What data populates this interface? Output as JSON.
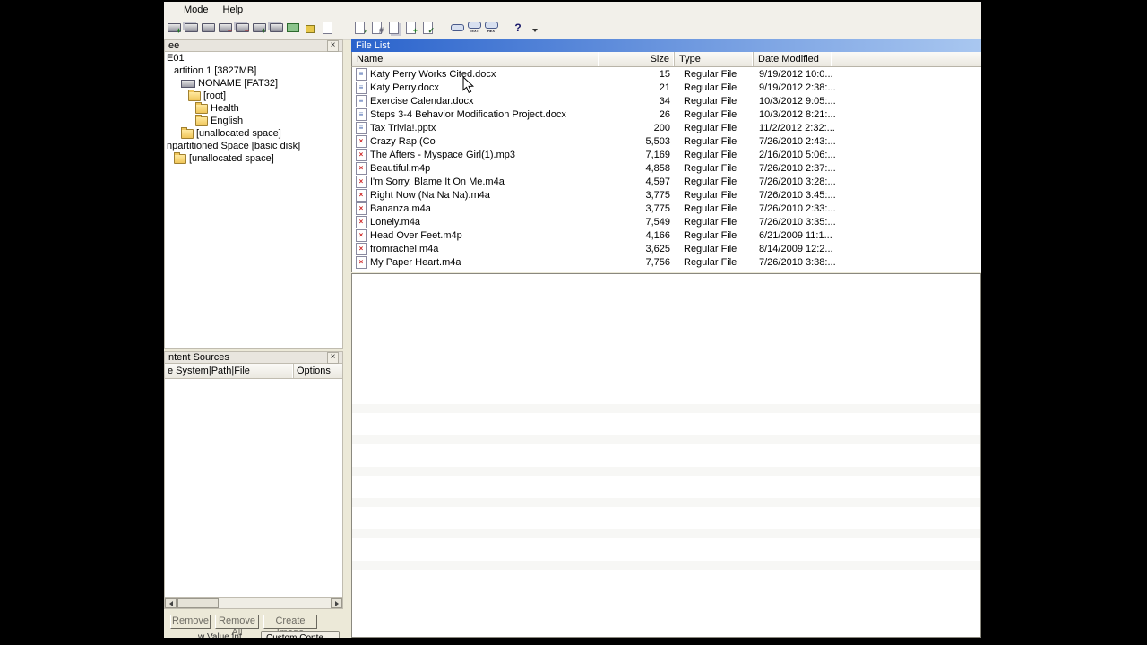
{
  "window": {
    "menu": {
      "items": [
        "Mode",
        "Help"
      ]
    },
    "toolbar": {
      "groups": [
        {
          "name": "evidence-group",
          "items": [
            {
              "name": "add-evidence-item-icon",
              "type": "disk",
              "badge": "+",
              "badge_color": "#1a7d1a"
            },
            {
              "name": "add-all-attached-devices-icon",
              "type": "disks",
              "badge": "",
              "badge_color": ""
            },
            {
              "name": "image-mounting-icon",
              "type": "disk",
              "badge": "",
              "badge_color": ""
            },
            {
              "name": "remove-evidence-item-icon",
              "type": "disk",
              "badge": "−",
              "badge_color": "#b22222"
            },
            {
              "name": "remove-all-evidence-items-icon",
              "type": "disks",
              "badge": "−",
              "badge_color": "#b22222"
            },
            {
              "name": "create-disk-image-icon",
              "type": "disk",
              "badge": "+",
              "badge_color": "#2a6a2a"
            },
            {
              "name": "export-disk-image-icon",
              "type": "disks",
              "badge": "",
              "badge_color": ""
            },
            {
              "name": "capture-memory-icon",
              "type": "mem",
              "badge": "",
              "badge_color": ""
            },
            {
              "name": "obtain-protected-files-icon",
              "type": "lock",
              "badge": "",
              "badge_color": ""
            },
            {
              "name": "detect-efs-encryption-icon",
              "type": "page",
              "badge": "",
              "badge_color": ""
            }
          ]
        },
        {
          "name": "export-group",
          "items": [
            {
              "name": "export-files-icon",
              "type": "page",
              "badge": "›",
              "badge_color": "#2a6a2a"
            },
            {
              "name": "export-file-hash-list-icon",
              "type": "page",
              "badge": "#",
              "badge_color": "#555566"
            },
            {
              "name": "export-directory-listing-icon",
              "type": "pages",
              "badge": "",
              "badge_color": ""
            },
            {
              "name": "add-to-custom-content-icon",
              "type": "page",
              "badge": "+",
              "badge_color": "#1a7d1a"
            },
            {
              "name": "verify-image-icon",
              "type": "page",
              "badge": "✓",
              "badge_color": "#2a6a2a"
            }
          ]
        },
        {
          "name": "view-mode-group",
          "items": [
            {
              "name": "auto-view-icon",
              "type": "view",
              "label": ""
            },
            {
              "name": "text-view-icon",
              "type": "view",
              "label": "TEXT"
            },
            {
              "name": "hex-view-icon",
              "type": "view",
              "label": "HEX"
            }
          ]
        },
        {
          "name": "help-group",
          "items": [
            {
              "name": "help-icon",
              "type": "help",
              "label": "?"
            },
            {
              "name": "toolbar-options-icon",
              "type": "caret",
              "label": ""
            }
          ]
        }
      ]
    }
  },
  "evidence_tree": {
    "title": "ee",
    "items": [
      {
        "label": "E01",
        "depth": 0,
        "icon": ""
      },
      {
        "label": "artition 1 [3827MB]",
        "depth": 1,
        "icon": ""
      },
      {
        "label": "NONAME [FAT32]",
        "depth": 2,
        "icon": "drive"
      },
      {
        "label": "[root]",
        "depth": 3,
        "icon": "folder"
      },
      {
        "label": "Health",
        "depth": 4,
        "icon": "folder"
      },
      {
        "label": "English",
        "depth": 4,
        "icon": "folder"
      },
      {
        "label": "[unallocated space]",
        "depth": 2,
        "icon": "folder"
      },
      {
        "label": "npartitioned Space [basic disk]",
        "depth": 0,
        "icon": ""
      },
      {
        "label": "[unallocated space]",
        "depth": 1,
        "icon": "folder"
      }
    ]
  },
  "file_list": {
    "title": "File List",
    "columns": [
      "Name",
      "Size",
      "Type",
      "Date Modified"
    ],
    "rows": [
      {
        "icon": "doc",
        "name": "Katy Perry Works Cited.docx",
        "size": "15",
        "type": "Regular File",
        "modified": "9/19/2012 10:0..."
      },
      {
        "icon": "doc",
        "name": "Katy Perry.docx",
        "size": "21",
        "type": "Regular File",
        "modified": "9/19/2012 2:38:..."
      },
      {
        "icon": "doc",
        "name": "Exercise Calendar.docx",
        "size": "34",
        "type": "Regular File",
        "modified": "10/3/2012 9:05:..."
      },
      {
        "icon": "doc",
        "name": "Steps 3-4 Behavior Modification Project.docx",
        "size": "26",
        "type": "Regular File",
        "modified": "10/3/2012 8:21:..."
      },
      {
        "icon": "doc",
        "name": "Tax Trivia!.pptx",
        "size": "200",
        "type": "Regular File",
        "modified": "11/2/2012 2:32:..."
      },
      {
        "icon": "media",
        "name": "Crazy Rap (Co",
        "size": "5,503",
        "type": "Regular File",
        "modified": "7/26/2010 2:43:..."
      },
      {
        "icon": "media",
        "name": "The Afters - Myspace Girl(1).mp3",
        "size": "7,169",
        "type": "Regular File",
        "modified": "2/16/2010 5:06:..."
      },
      {
        "icon": "media",
        "name": "Beautiful.m4p",
        "size": "4,858",
        "type": "Regular File",
        "modified": "7/26/2010 2:37:..."
      },
      {
        "icon": "media",
        "name": "I'm Sorry, Blame It On Me.m4a",
        "size": "4,597",
        "type": "Regular File",
        "modified": "7/26/2010 3:28:..."
      },
      {
        "icon": "media",
        "name": "Right Now (Na Na Na).m4a",
        "size": "3,775",
        "type": "Regular File",
        "modified": "7/26/2010 3:45:..."
      },
      {
        "icon": "media",
        "name": "Bananza.m4a",
        "size": "3,775",
        "type": "Regular File",
        "modified": "7/26/2010 2:33:..."
      },
      {
        "icon": "media",
        "name": "Lonely.m4a",
        "size": "7,549",
        "type": "Regular File",
        "modified": "7/26/2010 3:35:..."
      },
      {
        "icon": "media",
        "name": "Head Over Feet.m4p",
        "size": "4,166",
        "type": "Regular File",
        "modified": "6/21/2009 11:1..."
      },
      {
        "icon": "media",
        "name": "fromrachel.m4a",
        "size": "3,625",
        "type": "Regular File",
        "modified": "8/14/2009 12:2..."
      },
      {
        "icon": "media",
        "name": "My Paper Heart.m4a",
        "size": "7,756",
        "type": "Regular File",
        "modified": "7/26/2010 3:38:..."
      }
    ]
  },
  "content_sources": {
    "title": "ntent Sources",
    "columns": [
      "e System|Path|File",
      "Options"
    ],
    "buttons": [
      "Remove",
      "Remove All",
      "Create Image"
    ]
  },
  "bottom_tabs": [
    "w Value Int",
    "Custom Conte"
  ],
  "colors": {
    "caption_start": "#2a63cc",
    "caption_end": "#a9c7f0",
    "chrome": "#ece9d8"
  }
}
